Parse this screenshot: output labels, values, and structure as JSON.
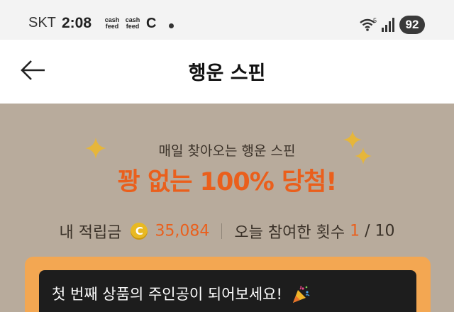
{
  "status_bar": {
    "carrier": "SKT",
    "time": "2:08",
    "app_icon_1": "cash feed",
    "app_icon_1_line1": "cash",
    "app_icon_1_line2": "feed",
    "app_icon_2": "cash feed",
    "app_icon_2_line1": "cash",
    "app_icon_2_line2": "feed",
    "app_icon_3": "C",
    "wifi_label": "5",
    "battery": "92"
  },
  "header": {
    "title": "행운 스핀",
    "back_icon": "arrow-left-icon"
  },
  "hero": {
    "subtitle": "매일 찾아오는 행운 스핀",
    "title": "꽝 없는 100% 당첨!",
    "points_label": "내 적립금",
    "coin_symbol": "C",
    "points_value": "35,084",
    "participation_label": "오늘 참여한 횟수",
    "participation_current": "1",
    "participation_separator": "/",
    "participation_total": "10"
  },
  "banner": {
    "text": "첫 번째 상품의 주인공이 되어보세요!",
    "icon": "party-popper-icon"
  },
  "colors": {
    "accent": "#ea5f1c",
    "background": "#b8ab9c",
    "card": "#f3a752",
    "banner": "#1d1d1d"
  }
}
